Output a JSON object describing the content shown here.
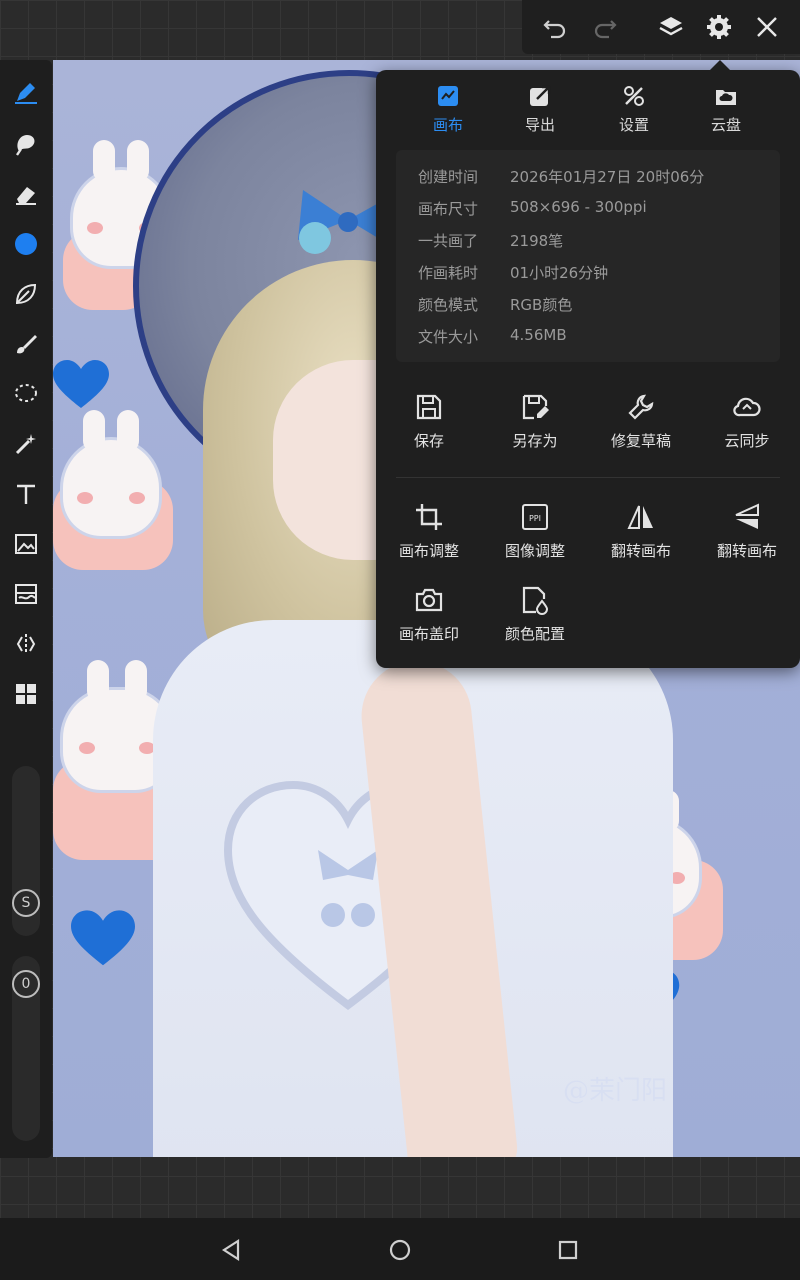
{
  "toolbar": {
    "icons": [
      "undo-icon",
      "redo-icon",
      "layers-icon",
      "settings-icon",
      "close-icon"
    ]
  },
  "toolrail": {
    "tools": [
      "pen-icon",
      "smudge-icon",
      "eraser-icon",
      "color-dot",
      "leaf-brush-icon",
      "paint-brush-icon",
      "lasso-icon",
      "magic-wand-icon",
      "text-icon",
      "image-import-icon",
      "picture-adjust-icon",
      "symmetry-icon",
      "grid-layout-icon"
    ],
    "size_label": "S",
    "opacity_label": "0"
  },
  "canvas": {
    "watermark": "@茉门阳"
  },
  "panel": {
    "tabs": [
      {
        "label": "画布",
        "active": true
      },
      {
        "label": "导出",
        "active": false
      },
      {
        "label": "设置",
        "active": false
      },
      {
        "label": "云盘",
        "active": false
      }
    ],
    "info": [
      {
        "key": "创建时间",
        "value": "2026年01月27日 20时06分"
      },
      {
        "key": "画布尺寸",
        "value": "508×696 - 300ppi"
      },
      {
        "key": "一共画了",
        "value": "2198笔"
      },
      {
        "key": "作画耗时",
        "value": "01小时26分钟"
      },
      {
        "key": "颜色模式",
        "value": "RGB颜色"
      },
      {
        "key": "文件大小",
        "value": "4.56MB"
      }
    ],
    "actions_top": [
      {
        "label": "保存",
        "icon": "save-icon"
      },
      {
        "label": "另存为",
        "icon": "save-as-icon"
      },
      {
        "label": "修复草稿",
        "icon": "wrench-icon"
      },
      {
        "label": "云同步",
        "icon": "cloud-sync-icon"
      }
    ],
    "actions_bottom": [
      {
        "label": "画布调整",
        "icon": "crop-icon"
      },
      {
        "label": "图像调整",
        "icon": "ppi-icon"
      },
      {
        "label": "翻转画布",
        "icon": "flip-horizontal-icon"
      },
      {
        "label": "翻转画布",
        "icon": "flip-vertical-icon"
      },
      {
        "label": "画布盖印",
        "icon": "camera-icon"
      },
      {
        "label": "颜色配置",
        "icon": "color-profile-icon"
      }
    ]
  },
  "colors": {
    "accent": "#2c8df2",
    "panel_bg": "#1f1f1f",
    "color_dot": "#1e7ff0"
  },
  "navbar": {
    "icons": [
      "back-icon",
      "home-icon",
      "recents-icon"
    ]
  }
}
